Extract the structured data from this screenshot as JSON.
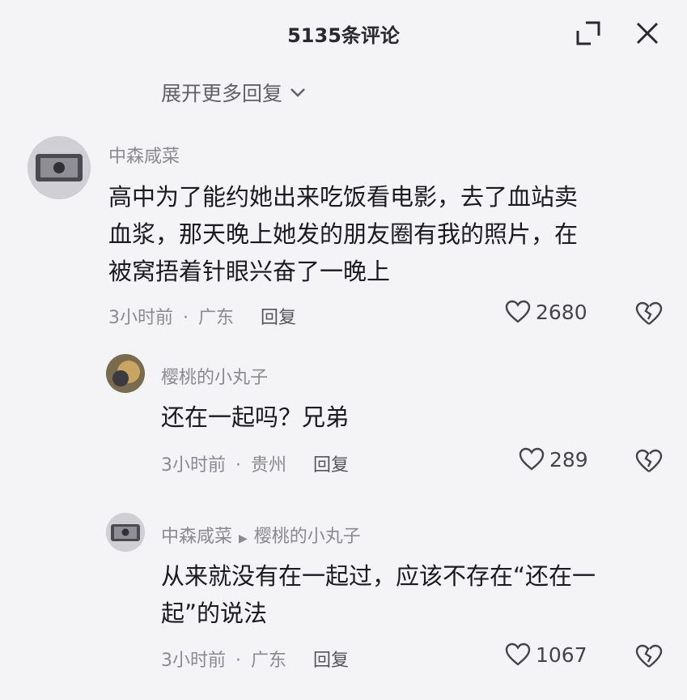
{
  "header": {
    "title": "5135条评论"
  },
  "expand_more_label": "展开更多回复",
  "comments": [
    {
      "user": "中森咸菜",
      "text_line1": "高中为了能约她出来吃饭看电影，去了血站卖",
      "text_line2": "血浆，那天晚上她发的朋友圈有我的照片，在",
      "text_line3": "被窝捂着针眼兴奋了一晚上",
      "time": "3小时前",
      "location": "广东",
      "reply_label": "回复",
      "likes": "2680"
    },
    {
      "user": "樱桃的小丸子",
      "text_line1": "还在一起吗？兄弟",
      "time": "3小时前",
      "location": "贵州",
      "reply_label": "回复",
      "likes": "289"
    },
    {
      "user": "中森咸菜",
      "reply_to": "樱桃的小丸子",
      "text_line1": "从来就没有在一起过，应该不存在“还在一",
      "text_line2": "起”的说法",
      "time": "3小时前",
      "location": "广东",
      "reply_label": "回复",
      "likes": "1067"
    }
  ],
  "icons": {
    "minimize": "minimize-icon",
    "close": "close-icon",
    "like": "heart-icon",
    "dislike": "broken-heart-icon"
  }
}
